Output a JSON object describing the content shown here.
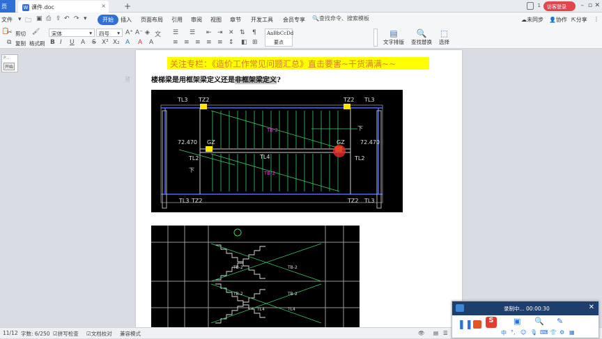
{
  "tabs": {
    "home": "页",
    "doc_title": "课件.doc",
    "doc_close": "×",
    "add": "+",
    "right_num": "1",
    "visitor": "访客登录"
  },
  "menu": {
    "file": "文件",
    "items": [
      "开始",
      "插入",
      "页面布局",
      "引用",
      "审阅",
      "视图",
      "章节",
      "开发工具",
      "会员专享"
    ],
    "search": "查找命令、搜索模板",
    "right": [
      "未同步",
      "协作",
      "分享"
    ]
  },
  "ribbon": {
    "cut": "剪切",
    "copy": "复制",
    "format_painter": "格式刷",
    "font_name": "宋体",
    "font_size": "四号",
    "style_preview": "AaBbCcDd",
    "style_name": "要点",
    "text_layout": "文字排版",
    "find_replace": "查找替换",
    "select": "选择"
  },
  "leftpanel": {
    "mini_label": "开始",
    "mini_top": "P..."
  },
  "document": {
    "banner": "关注专栏：《造价工作常见问题汇总》直击要害~干货满满~~",
    "question_pre": "楼梯梁是用框架梁定义还是",
    "question_hl": "非框架梁定义",
    "question_post": "?"
  },
  "cad": {
    "labels": [
      "TL3",
      "TZ2",
      "TZ2",
      "TL3",
      "72.470",
      "72.470",
      "GZ",
      "GZ",
      "TL2",
      "TL2",
      "TL4",
      "下",
      "下",
      "TB-2",
      "TB-2",
      "TL3",
      "TZ2",
      "TZ2",
      "TL3"
    ],
    "labels2": [
      "TB-2",
      "TB-2",
      "TB-2",
      "TL4",
      "TL4",
      "TB-2"
    ]
  },
  "status": {
    "page": "11/12",
    "words": "字数: 6/250",
    "spell": "拼写检查",
    "proof": "文档校对",
    "compat": "兼容模式"
  },
  "recorder": {
    "title": "录制中... 00:00:30",
    "ime_char": "中"
  }
}
